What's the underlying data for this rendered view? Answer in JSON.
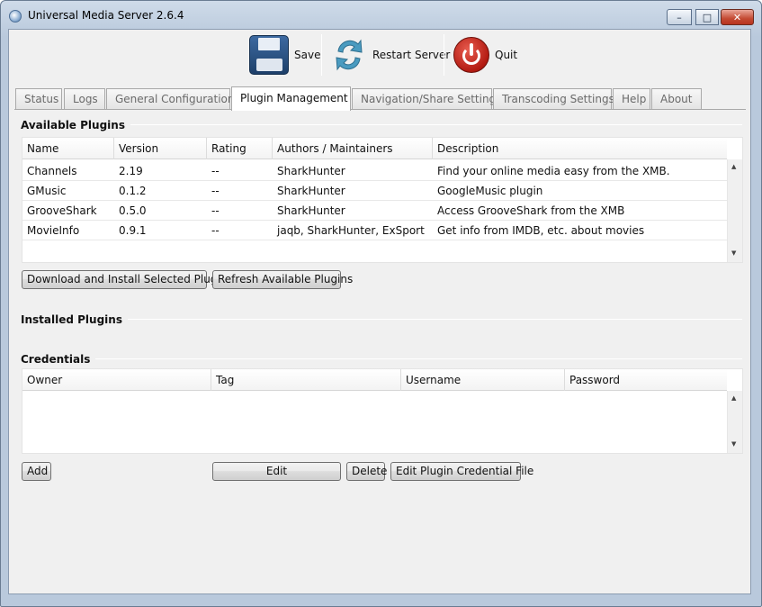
{
  "window": {
    "title": "Universal Media Server 2.6.4",
    "minimize_glyph": "–",
    "maximize_glyph": "□",
    "close_glyph": "✕"
  },
  "toolbar": {
    "save_label": "Save",
    "restart_label": "Restart Server",
    "quit_label": "Quit",
    "icons": [
      "floppy-disk-icon",
      "restart-arrows-icon",
      "power-icon"
    ],
    "colors": {
      "save": "#2b5283",
      "restart": "#4a9bc0",
      "quit": "#c0231a"
    }
  },
  "tabs": [
    {
      "label": "Status"
    },
    {
      "label": "Logs"
    },
    {
      "label": "General Configuration"
    },
    {
      "label": "Plugin Management",
      "active": true
    },
    {
      "label": "Navigation/Share Settings"
    },
    {
      "label": "Transcoding Settings"
    },
    {
      "label": "Help"
    },
    {
      "label": "About"
    }
  ],
  "available_plugins": {
    "title": "Available Plugins",
    "columns": [
      "Name",
      "Version",
      "Rating",
      "Authors / Maintainers",
      "Description"
    ],
    "rows": [
      [
        "Channels",
        "2.19",
        "--",
        "SharkHunter",
        "Find your online media easy from the XMB."
      ],
      [
        "GMusic",
        "0.1.2",
        "--",
        "SharkHunter",
        "GoogleMusic plugin"
      ],
      [
        "GrooveShark",
        "0.5.0",
        "--",
        "SharkHunter",
        "Access GrooveShark from the XMB"
      ],
      [
        "MovieInfo",
        "0.9.1",
        "--",
        "jaqb, SharkHunter, ExSport",
        "Get info from IMDB, etc. about movies"
      ]
    ],
    "download_button": "Download and Install Selected Plugin",
    "refresh_button": "Refresh Available Plugins"
  },
  "installed_plugins": {
    "title": "Installed Plugins"
  },
  "credentials": {
    "title": "Credentials",
    "columns": [
      "Owner",
      "Tag",
      "Username",
      "Password"
    ],
    "add_button": "Add",
    "edit_button": "Edit",
    "delete_button": "Delete",
    "edit_file_button": "Edit Plugin Credential File"
  }
}
